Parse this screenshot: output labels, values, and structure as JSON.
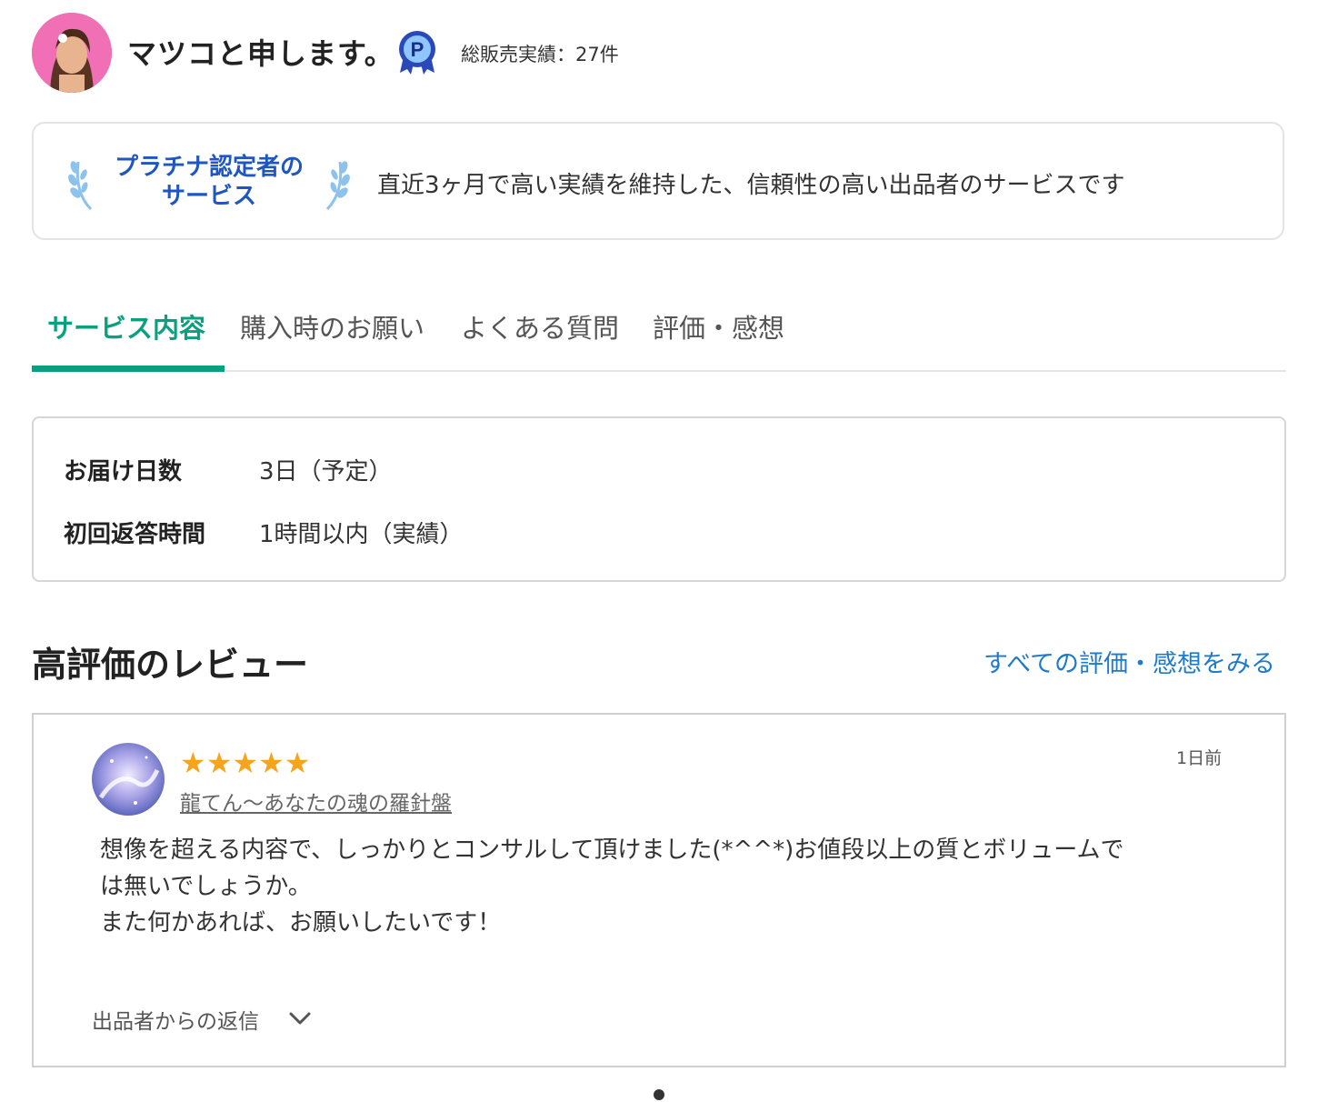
{
  "seller": {
    "name": "マツコと申します。",
    "sales_label": "総販売実績：27件",
    "badge_letter": "P"
  },
  "platinum": {
    "title_line1": "プラチナ認定者の",
    "title_line2": "サービス",
    "description": "直近3ヶ月で高い実績を維持した、信頼性の高い出品者のサービスです"
  },
  "tabs": [
    {
      "label": "サービス内容",
      "active": true
    },
    {
      "label": "購入時のお願い",
      "active": false
    },
    {
      "label": "よくある質問",
      "active": false
    },
    {
      "label": "評価・感想",
      "active": false
    }
  ],
  "info": {
    "delivery_label": "お届け日数",
    "delivery_value": "3日（予定）",
    "response_label": "初回返答時間",
    "response_value": "1時間以内（実績）"
  },
  "reviews": {
    "title": "高評価のレビュー",
    "see_all": "すべての評価・感想をみる",
    "items": [
      {
        "stars": "★★★★★",
        "rating": 5,
        "reviewer": "龍てん〜あなたの魂の羅針盤",
        "date": "1日前",
        "text_line1": "想像を超える内容で、しっかりとコンサルして頂けました(*^^*)お値段以上の質とボリュームで",
        "text_line2": "は無いでしょうか。",
        "text_line3": "また何かあれば、お願いしたいです！",
        "reply_toggle": "出品者からの返信"
      }
    ]
  },
  "colors": {
    "accent_green": "#0aa07f",
    "link_blue": "#1f7ac9",
    "platinum_blue": "#1e56c2",
    "star_orange": "#f7a31b"
  }
}
